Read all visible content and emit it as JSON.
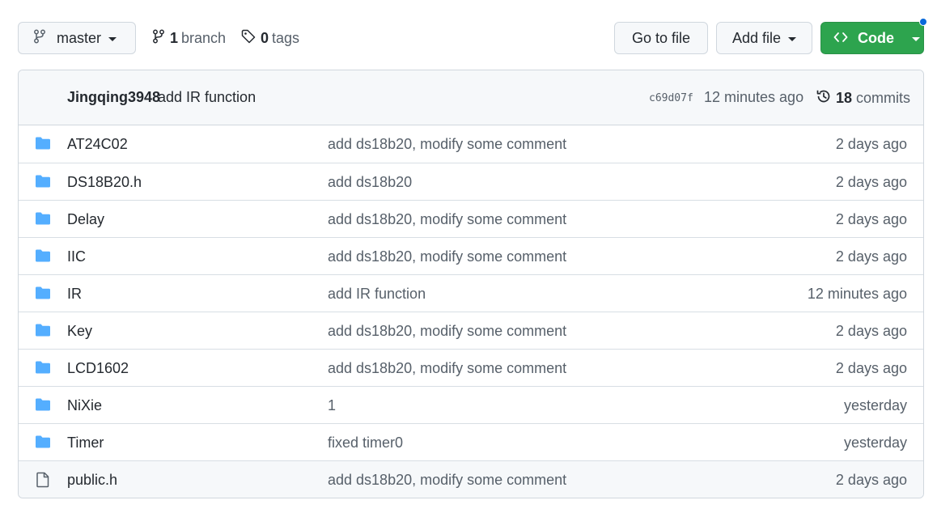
{
  "branch_selector": {
    "label": "master",
    "icon": "git-branch-icon"
  },
  "branches": {
    "count": "1",
    "label": "branch",
    "icon": "git-branch-icon"
  },
  "tags": {
    "count": "0",
    "label": "tags",
    "icon": "tag-icon"
  },
  "actions": {
    "go_to_file": "Go to file",
    "add_file": "Add file",
    "code": "Code"
  },
  "colors": {
    "primary_green": "#2da44e",
    "folder_blue": "#54aeff",
    "notification_blue": "#0969da"
  },
  "latest_commit": {
    "author": "Jingqing3948",
    "message": "add IR function",
    "sha": "c69d07f",
    "time": "12 minutes ago",
    "commit_count": "18",
    "commits_label": "commits"
  },
  "files": [
    {
      "name": "AT24C02",
      "type": "folder",
      "message": "add ds18b20, modify some comment",
      "age": "2 days ago"
    },
    {
      "name": "DS18B20.h",
      "type": "folder",
      "message": "add ds18b20",
      "age": "2 days ago"
    },
    {
      "name": "Delay",
      "type": "folder",
      "message": "add ds18b20, modify some comment",
      "age": "2 days ago"
    },
    {
      "name": "IIC",
      "type": "folder",
      "message": "add ds18b20, modify some comment",
      "age": "2 days ago"
    },
    {
      "name": "IR",
      "type": "folder",
      "message": "add IR function",
      "age": "12 minutes ago"
    },
    {
      "name": "Key",
      "type": "folder",
      "message": "add ds18b20, modify some comment",
      "age": "2 days ago"
    },
    {
      "name": "LCD1602",
      "type": "folder",
      "message": "add ds18b20, modify some comment",
      "age": "2 days ago"
    },
    {
      "name": "NiXie",
      "type": "folder",
      "message": "1",
      "age": "yesterday"
    },
    {
      "name": "Timer",
      "type": "folder",
      "message": "fixed timer0",
      "age": "yesterday"
    },
    {
      "name": "public.h",
      "type": "file",
      "message": "add ds18b20, modify some comment",
      "age": "2 days ago"
    }
  ]
}
